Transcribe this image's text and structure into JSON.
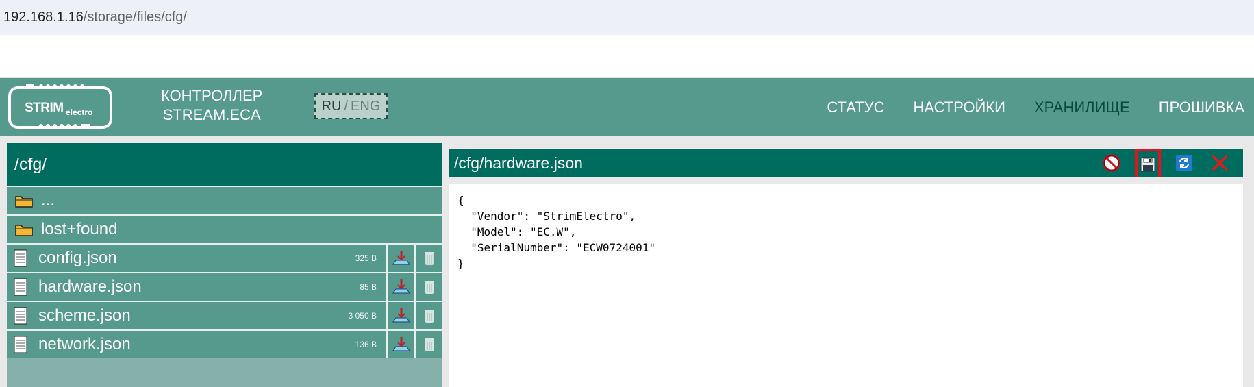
{
  "browser": {
    "url_host": "192.168.1.16",
    "url_path": "/storage/files/cfg/"
  },
  "header": {
    "logo_main": "STRIM",
    "logo_sub": "electro",
    "product_line1": "КОНТРОЛЛЕР",
    "product_line2": "STREAM.ECA",
    "lang_ru": "RU",
    "lang_sep": "/",
    "lang_eng": "ENG",
    "nav": [
      {
        "label": "СТАТУС"
      },
      {
        "label": "НАСТРОЙКИ"
      },
      {
        "label": "ХРАНИЛИЩЕ",
        "active": true
      },
      {
        "label": "ПРОШИВКА"
      }
    ]
  },
  "files": {
    "path": "/cfg/",
    "folders": [
      {
        "name": "...",
        "icon": "folder-icon"
      },
      {
        "name": "lost+found",
        "icon": "folder-icon"
      }
    ],
    "items": [
      {
        "name": "config.json",
        "size": "325 B"
      },
      {
        "name": "hardware.json",
        "size": "85 B"
      },
      {
        "name": "scheme.json",
        "size": "3 050 B"
      },
      {
        "name": "network.json",
        "size": "136 B"
      }
    ]
  },
  "editor": {
    "path": "/cfg/hardware.json",
    "content": "{\n  \"Vendor\": \"StrimElectro\",\n  \"Model\": \"EC.W\",\n  \"SerialNumber\": \"ECW0724001\"\n}",
    "tools": [
      "cancel-icon",
      "save-icon",
      "reload-icon",
      "close-icon"
    ]
  },
  "colors": {
    "header_bg": "#559a8d",
    "title_bg": "#006b5f",
    "active_nav": "#074a40",
    "highlight": "#e8101c"
  }
}
